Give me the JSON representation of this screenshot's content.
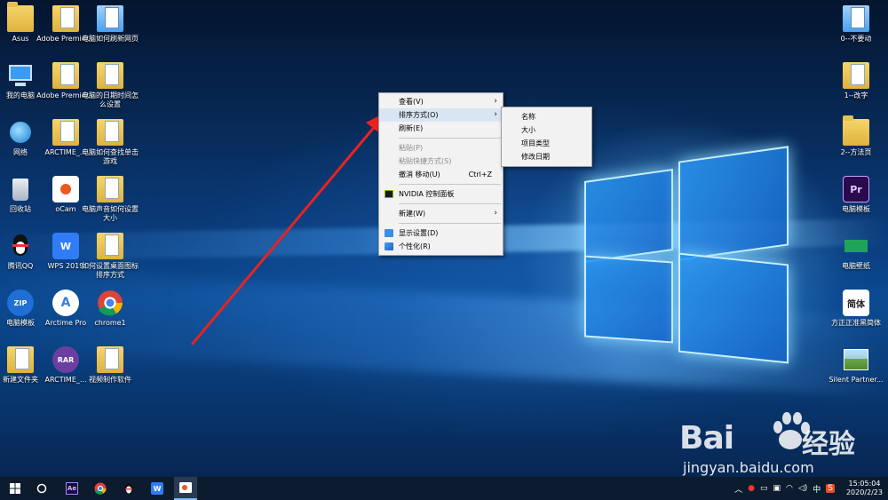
{
  "desktop_left": [
    {
      "label": "Asus",
      "kind": "folder"
    },
    {
      "label": "Adobe Premier...",
      "kind": "docfolder"
    },
    {
      "label": "电脑如何刷新网页",
      "kind": "bluefolder"
    },
    {
      "label": "我的电脑",
      "kind": "computer"
    },
    {
      "label": "Adobe Premier...",
      "kind": "docfolder"
    },
    {
      "label": "电脑的日期时间怎么设置",
      "kind": "docfolder"
    },
    {
      "label": "网络",
      "kind": "network"
    },
    {
      "label": "ARCTIME_...",
      "kind": "docfolder"
    },
    {
      "label": "电脑如何查找单击游戏",
      "kind": "docfolder"
    },
    {
      "label": "回收站",
      "kind": "recycle"
    },
    {
      "label": "oCam",
      "kind": "ocam"
    },
    {
      "label": "电脑声音如何设置大小",
      "kind": "docfolder"
    },
    {
      "label": "腾讯QQ",
      "kind": "qq"
    },
    {
      "label": "WPS 2019",
      "kind": "wps"
    },
    {
      "label": "如何设置桌面图标排序方式",
      "kind": "docfolder"
    },
    {
      "label": "电脑模板",
      "kind": "zip"
    },
    {
      "label": "Arctime Pro",
      "kind": "arctime"
    },
    {
      "label": "chrome1",
      "kind": "chrome"
    },
    {
      "label": "新建文件夹",
      "kind": "docfolder"
    },
    {
      "label": "ARCTIME_...",
      "kind": "rar"
    },
    {
      "label": "视频制作软件",
      "kind": "docfolder"
    }
  ],
  "desktop_right": [
    {
      "label": "0--不要动",
      "kind": "bluefolder"
    },
    {
      "label": "1--改字",
      "kind": "docfolder"
    },
    {
      "label": "2--方法页",
      "kind": "folder"
    },
    {
      "label": "电脑模板",
      "kind": "prproj"
    },
    {
      "label": "电脑壁纸",
      "kind": "green"
    },
    {
      "label": "方正正准黑简体",
      "kind": "font"
    },
    {
      "label": "Silent Partner...",
      "kind": "photo"
    }
  ],
  "context_menu": {
    "items": [
      {
        "label": "查看(V)",
        "has_sub": true
      },
      {
        "label": "排序方式(O)",
        "has_sub": true,
        "highlight": true
      },
      {
        "label": "刷新(E)"
      },
      {
        "label": "粘贴(P)",
        "disabled": true
      },
      {
        "label": "粘贴快捷方式(S)",
        "disabled": true
      },
      {
        "label": "撤消 移动(U)",
        "shortcut": "Ctrl+Z"
      },
      {
        "label": "NVIDIA 控制面板",
        "icon": "nvidia"
      },
      {
        "label": "新建(W)",
        "has_sub": true
      },
      {
        "label": "显示设置(D)",
        "icon": "display"
      },
      {
        "label": "个性化(R)",
        "icon": "personalize"
      }
    ],
    "submenu": [
      "名称",
      "大小",
      "项目类型",
      "修改日期"
    ]
  },
  "watermark": {
    "brand": "Bai",
    "brand2": "经验",
    "url": "jingyan.baidu.com"
  },
  "taskbar": {
    "tray_lang": "中",
    "clock_time": "15:05:04",
    "clock_date": "2020/2/23"
  },
  "colors": {
    "menu_highlight": "#d8e6f3",
    "arrow": "#e8231f",
    "taskbar": "#0c1b2e"
  }
}
